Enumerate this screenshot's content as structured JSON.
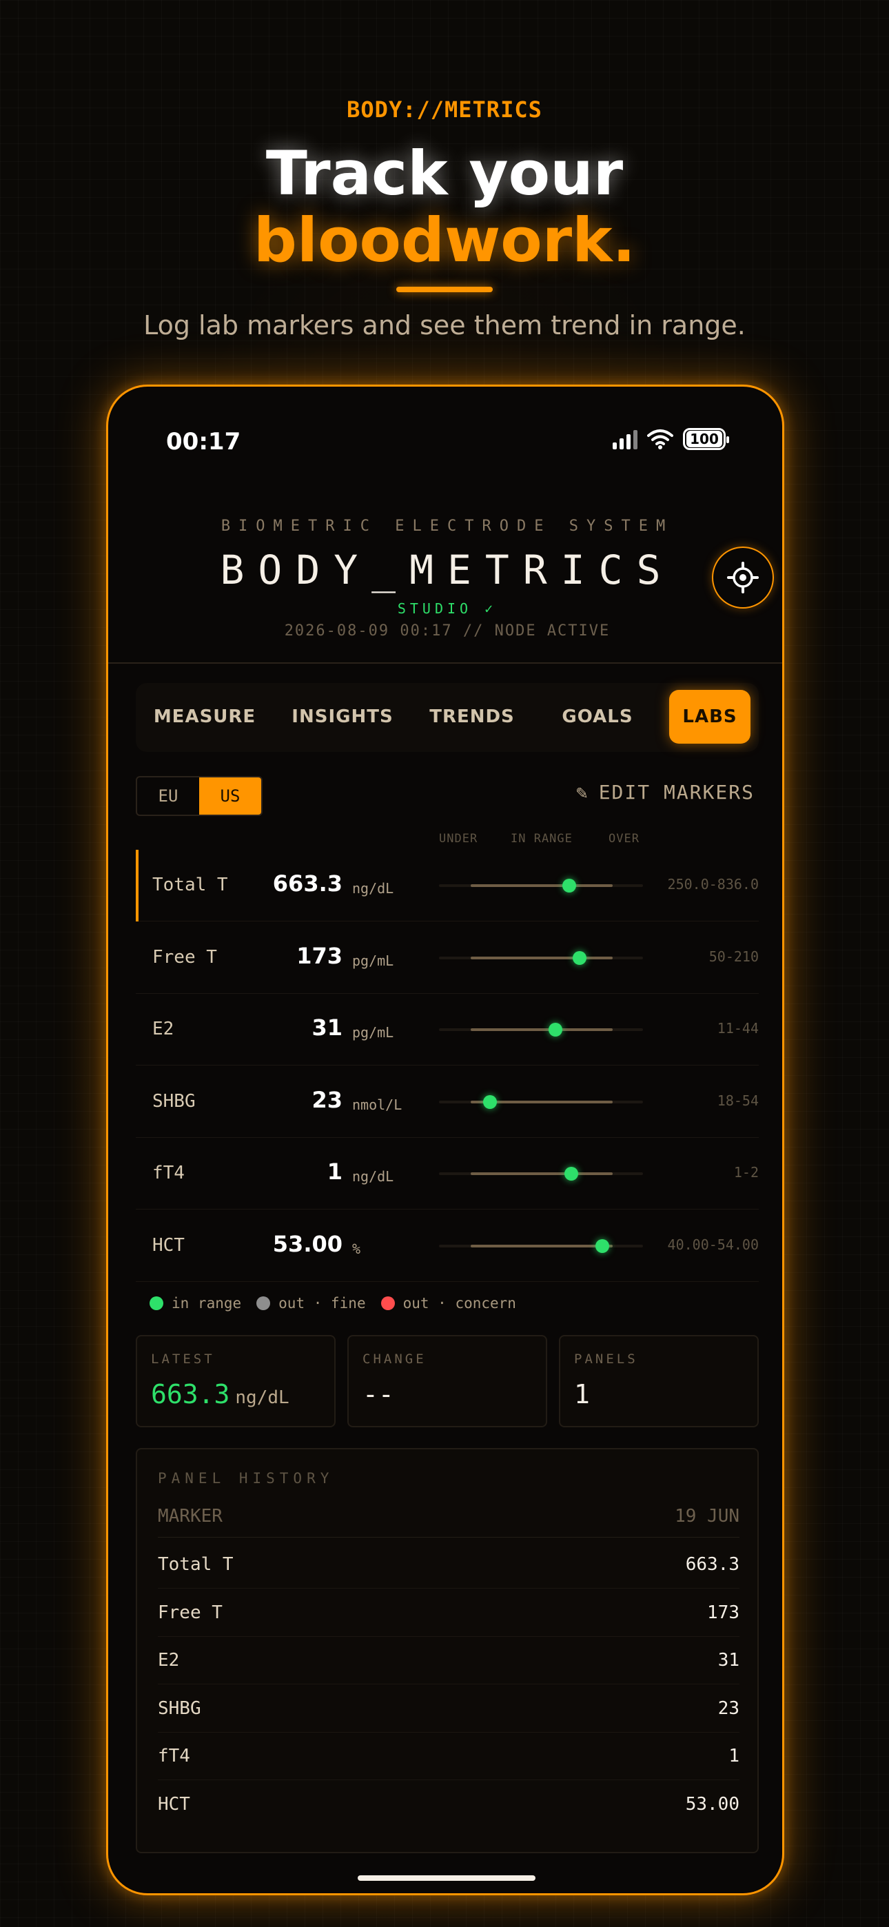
{
  "hero": {
    "tag": "BODY://METRICS",
    "line1": "Track your",
    "line2": "bloodwork.",
    "subtitle": "Log lab markers and see them trend in range."
  },
  "status_bar": {
    "time": "00:17",
    "battery": "100"
  },
  "header": {
    "system": "BIOMETRIC ELECTRODE SYSTEM",
    "title": "BODY_METRICS",
    "studio": "STUDIO ✓",
    "timestamp": "2026-08-09 00:17 // NODE ACTIVE"
  },
  "tabs": [
    {
      "label": "MEASURE",
      "active": false
    },
    {
      "label": "INSIGHTS",
      "active": false
    },
    {
      "label": "TRENDS",
      "active": false
    },
    {
      "label": "GOALS",
      "active": false
    },
    {
      "label": "LABS",
      "active": true
    }
  ],
  "units": {
    "options": [
      "EU",
      "US"
    ],
    "selected": "US"
  },
  "edit_markers": {
    "icon": "pencil-icon",
    "label": "EDIT MARKERS"
  },
  "range_headers": {
    "under": "UNDER",
    "in_range": "IN RANGE",
    "over": "OVER"
  },
  "markers": [
    {
      "name": "Total T",
      "value": "663.3",
      "unit": "ng/dL",
      "range": "250.0-836.0",
      "position": 0.64,
      "status": "in range",
      "selected": true
    },
    {
      "name": "Free T",
      "value": "173",
      "unit": "pg/mL",
      "range": "50-210",
      "position": 0.69,
      "status": "in range",
      "selected": false
    },
    {
      "name": "E2",
      "value": "31",
      "unit": "pg/mL",
      "range": "11-44",
      "position": 0.57,
      "status": "in range",
      "selected": false
    },
    {
      "name": "SHBG",
      "value": "23",
      "unit": "nmol/L",
      "range": "18-54",
      "position": 0.25,
      "status": "in range",
      "selected": false
    },
    {
      "name": "fT4",
      "value": "1",
      "unit": "ng/dL",
      "range": "1-2",
      "position": 0.65,
      "status": "in range",
      "selected": false
    },
    {
      "name": "HCT",
      "value": "53.00",
      "unit": "%",
      "range": "40.00-54.00",
      "position": 0.8,
      "status": "in range",
      "selected": false
    }
  ],
  "legend": [
    {
      "label": "in range",
      "color": "#2ee06a"
    },
    {
      "label": "out · fine",
      "color": "#8e8e8e"
    },
    {
      "label": "out · concern",
      "color": "#ff4d4d"
    }
  ],
  "stats": {
    "latest": {
      "label": "LATEST",
      "value": "663.3",
      "unit": "ng/dL"
    },
    "change": {
      "label": "CHANGE",
      "value": "--"
    },
    "panels": {
      "label": "PANELS",
      "value": "1"
    }
  },
  "history": {
    "title": "PANEL HISTORY",
    "col_marker": "MARKER",
    "col_date": "19 JUN",
    "rows": [
      {
        "marker": "Total T",
        "value": "663.3"
      },
      {
        "marker": "Free T",
        "value": "173"
      },
      {
        "marker": "E2",
        "value": "31"
      },
      {
        "marker": "SHBG",
        "value": "23"
      },
      {
        "marker": "fT4",
        "value": "1"
      },
      {
        "marker": "HCT",
        "value": "53.00"
      }
    ]
  },
  "colors": {
    "accent": "#ff9500",
    "in_range": "#2ee06a",
    "background": "#0b0906"
  }
}
